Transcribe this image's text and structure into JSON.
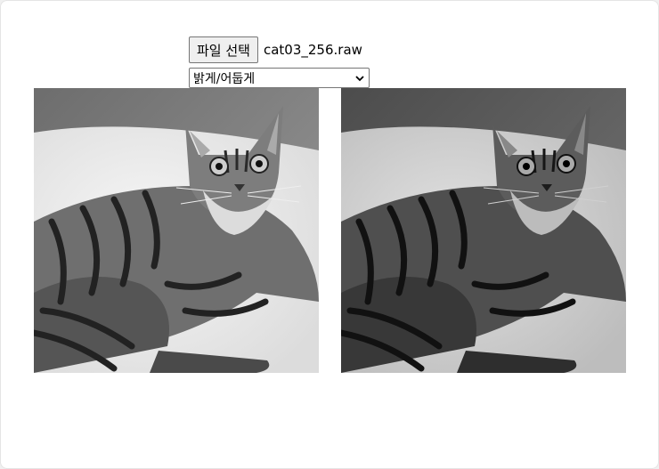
{
  "file_input": {
    "button_label": "파일 선택",
    "file_name": "cat03_256.raw"
  },
  "mode_select": {
    "selected": "밝게/어둡게"
  }
}
